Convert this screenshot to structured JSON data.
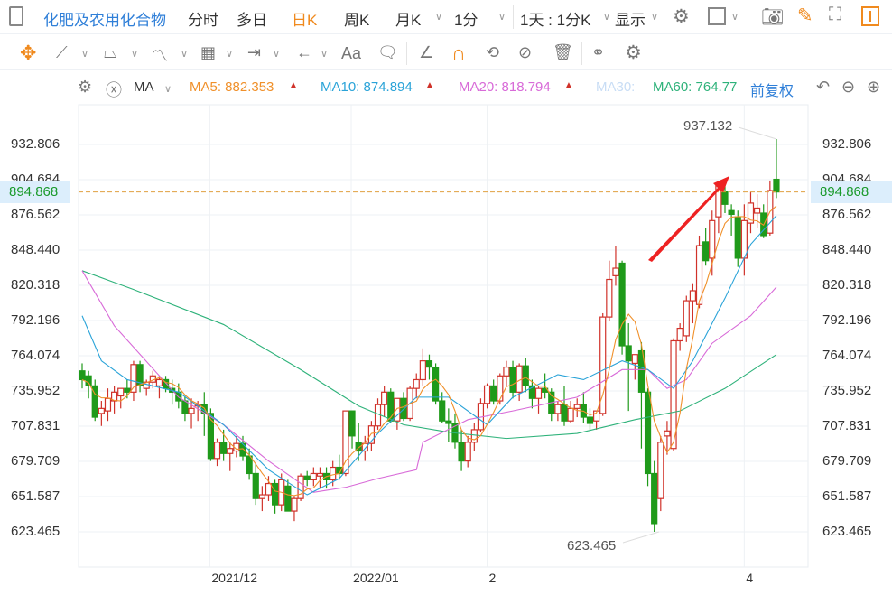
{
  "toolbar": {
    "symbol": "化肥及农用化合物",
    "tabs": [
      "分时",
      "多日",
      "日K",
      "周K",
      "月K"
    ],
    "active_tab": "日K",
    "interval": "1分",
    "range": "1天 : 1分K",
    "display": "显示"
  },
  "indicators": {
    "type": "MA",
    "ma5": "MA5: 882.353",
    "ma10": "MA10: 874.894",
    "ma20": "MA20: 818.794",
    "ma30": "MA30:",
    "ma60": "MA60: 764.77",
    "adjust": "前复权"
  },
  "colors": {
    "up": "#d0322a",
    "down": "#1f9a1a",
    "ma5": "#f0902a",
    "ma10": "#2aa3d8",
    "ma20": "#d86ad8",
    "ma30": "#c8ddf5",
    "ma60": "#2eb27a",
    "accent": "#2f7fd8",
    "active": "#f08a1e"
  },
  "chart_data": {
    "type": "candlestick",
    "yticks": [
      "932.806",
      "904.684",
      "876.562",
      "848.440",
      "820.318",
      "792.196",
      "764.074",
      "735.952",
      "707.831",
      "679.709",
      "651.587",
      "623.465"
    ],
    "ylim": [
      623.465,
      932.806
    ],
    "xticks": [
      {
        "label": "2021/12",
        "index": 20
      },
      {
        "label": "2022/01",
        "index": 42
      },
      {
        "label": "2",
        "index": 63
      },
      {
        "label": "4",
        "index": 103
      }
    ],
    "current_price": "894.868",
    "max_label": "937.132",
    "min_label": "623.465",
    "candles": [
      [
        752,
        758,
        738,
        745
      ],
      [
        748,
        752,
        730,
        740
      ],
      [
        740,
        745,
        712,
        715
      ],
      [
        718,
        728,
        708,
        722
      ],
      [
        720,
        738,
        712,
        730
      ],
      [
        728,
        740,
        718,
        735
      ],
      [
        732,
        738,
        722,
        738
      ],
      [
        738,
        745,
        730,
        735
      ],
      [
        735,
        760,
        728,
        757
      ],
      [
        757,
        760,
        735,
        740
      ],
      [
        738,
        745,
        732,
        743
      ],
      [
        743,
        752,
        738,
        748
      ],
      [
        740,
        748,
        730,
        745
      ],
      [
        745,
        748,
        735,
        738
      ],
      [
        738,
        745,
        725,
        735
      ],
      [
        735,
        742,
        722,
        728
      ],
      [
        728,
        732,
        712,
        718
      ],
      [
        718,
        730,
        706,
        722
      ],
      [
        724,
        728,
        712,
        725
      ],
      [
        725,
        735,
        700,
        718
      ],
      [
        718,
        722,
        680,
        682
      ],
      [
        682,
        698,
        676,
        695
      ],
      [
        695,
        705,
        680,
        686
      ],
      [
        686,
        695,
        672,
        690
      ],
      [
        688,
        700,
        683,
        694
      ],
      [
        694,
        700,
        680,
        684
      ],
      [
        684,
        690,
        665,
        670
      ],
      [
        670,
        678,
        645,
        650
      ],
      [
        650,
        660,
        640,
        653
      ],
      [
        653,
        668,
        648,
        662
      ],
      [
        662,
        665,
        638,
        645
      ],
      [
        645,
        670,
        640,
        665
      ],
      [
        660,
        665,
        640,
        640
      ],
      [
        640,
        652,
        632,
        650
      ],
      [
        650,
        670,
        648,
        668
      ],
      [
        668,
        672,
        660,
        665
      ],
      [
        665,
        675,
        660,
        670
      ],
      [
        668,
        675,
        658,
        670
      ],
      [
        670,
        675,
        658,
        665
      ],
      [
        665,
        680,
        660,
        675
      ],
      [
        675,
        685,
        665,
        670
      ],
      [
        670,
        720,
        668,
        720
      ],
      [
        720,
        720,
        690,
        700
      ],
      [
        695,
        710,
        680,
        688
      ],
      [
        688,
        700,
        680,
        694
      ],
      [
        694,
        712,
        688,
        708
      ],
      [
        708,
        730,
        705,
        725
      ],
      [
        725,
        740,
        715,
        735
      ],
      [
        735,
        738,
        710,
        712
      ],
      [
        712,
        730,
        705,
        730
      ],
      [
        730,
        735,
        712,
        714
      ],
      [
        714,
        740,
        712,
        738
      ],
      [
        738,
        750,
        730,
        745
      ],
      [
        745,
        770,
        740,
        760
      ],
      [
        760,
        765,
        745,
        755
      ],
      [
        755,
        758,
        725,
        728
      ],
      [
        728,
        735,
        710,
        712
      ],
      [
        712,
        722,
        695,
        710
      ],
      [
        710,
        718,
        690,
        695
      ],
      [
        695,
        705,
        672,
        680
      ],
      [
        680,
        700,
        675,
        695
      ],
      [
        695,
        710,
        688,
        705
      ],
      [
        705,
        730,
        703,
        726
      ],
      [
        726,
        742,
        722,
        740
      ],
      [
        740,
        745,
        725,
        728
      ],
      [
        728,
        750,
        725,
        748
      ],
      [
        748,
        760,
        740,
        755
      ],
      [
        755,
        760,
        730,
        735
      ],
      [
        735,
        758,
        728,
        756
      ],
      [
        756,
        762,
        735,
        740
      ],
      [
        740,
        745,
        722,
        730
      ],
      [
        730,
        740,
        718,
        738
      ],
      [
        738,
        750,
        730,
        735
      ],
      [
        735,
        738,
        712,
        718
      ],
      [
        718,
        728,
        712,
        725
      ],
      [
        725,
        740,
        708,
        712
      ],
      [
        712,
        728,
        710,
        722
      ],
      [
        722,
        730,
        715,
        725
      ],
      [
        725,
        735,
        710,
        715
      ],
      [
        715,
        722,
        705,
        710
      ],
      [
        712,
        720,
        705,
        720
      ],
      [
        718,
        798,
        716,
        795
      ],
      [
        795,
        840,
        792,
        825
      ],
      [
        828,
        852,
        820,
        834
      ],
      [
        838,
        840,
        765,
        772
      ],
      [
        772,
        790,
        720,
        760
      ],
      [
        758,
        765,
        745,
        765
      ],
      [
        768,
        775,
        690,
        735
      ],
      [
        735,
        738,
        660,
        670
      ],
      [
        670,
        680,
        623.465,
        630
      ],
      [
        650,
        700,
        640,
        695
      ],
      [
        700,
        712,
        685,
        704
      ],
      [
        690,
        778,
        688,
        776
      ],
      [
        776,
        790,
        768,
        786
      ],
      [
        780,
        812,
        775,
        808
      ],
      [
        808,
        822,
        790,
        816
      ],
      [
        805,
        860,
        802,
        852
      ],
      [
        855,
        866,
        836,
        840
      ],
      [
        842,
        880,
        828,
        872
      ],
      [
        875,
        902,
        862,
        900
      ],
      [
        895,
        905,
        878,
        885
      ],
      [
        880,
        885,
        860,
        877
      ],
      [
        875,
        880,
        835,
        842
      ],
      [
        842,
        885,
        828,
        872
      ],
      [
        870,
        895,
        862,
        886
      ],
      [
        878,
        893,
        866,
        882
      ],
      [
        878,
        885,
        858,
        860
      ],
      [
        862,
        904,
        860,
        896
      ],
      [
        905,
        937.132,
        890,
        894.868
      ]
    ],
    "ma10": [
      [
        0,
        796
      ],
      [
        3,
        760
      ],
      [
        7,
        745
      ],
      [
        15,
        735
      ],
      [
        22,
        709
      ],
      [
        29,
        673
      ],
      [
        35,
        653
      ],
      [
        40,
        666
      ],
      [
        46,
        702
      ],
      [
        52,
        731
      ],
      [
        57,
        731
      ],
      [
        63,
        709
      ],
      [
        67,
        731
      ],
      [
        74,
        749
      ],
      [
        78,
        745
      ],
      [
        84,
        760
      ],
      [
        88,
        753
      ],
      [
        92,
        738
      ],
      [
        95,
        760
      ],
      [
        100,
        810
      ],
      [
        104,
        853
      ],
      [
        108,
        876
      ]
    ],
    "ma20": [
      [
        0,
        832
      ],
      [
        5,
        788
      ],
      [
        15,
        731
      ],
      [
        22,
        709
      ],
      [
        29,
        680
      ],
      [
        36,
        655
      ],
      [
        41,
        659
      ],
      [
        46,
        666
      ],
      [
        52,
        673
      ],
      [
        53,
        695
      ],
      [
        60,
        713
      ],
      [
        67,
        720
      ],
      [
        77,
        731
      ],
      [
        84,
        753
      ],
      [
        88,
        753
      ],
      [
        91,
        738
      ],
      [
        94,
        745
      ],
      [
        98,
        774
      ],
      [
        104,
        796
      ],
      [
        108,
        819
      ]
    ],
    "ma60": [
      [
        0,
        832
      ],
      [
        8,
        817
      ],
      [
        22,
        789
      ],
      [
        34,
        753
      ],
      [
        43,
        724
      ],
      [
        50,
        709
      ],
      [
        57,
        703
      ],
      [
        66,
        698
      ],
      [
        77,
        702
      ],
      [
        86,
        713
      ],
      [
        93,
        720
      ],
      [
        100,
        738
      ],
      [
        108,
        765
      ]
    ]
  }
}
